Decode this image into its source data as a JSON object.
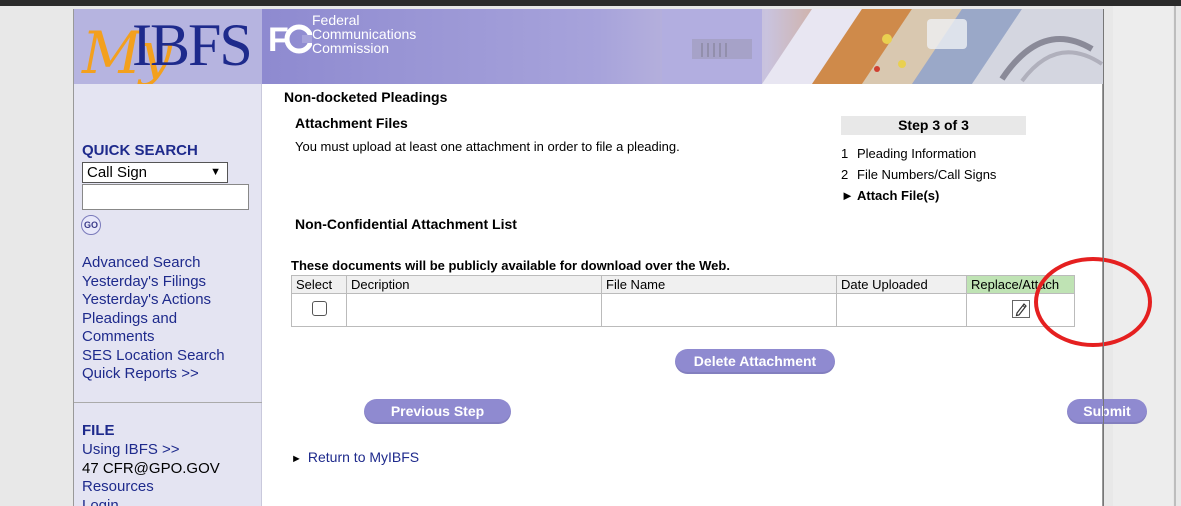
{
  "header": {
    "logo_my": "My",
    "logo_ibfs": "IBFS",
    "fcc_lines": [
      "Federal",
      "Communications",
      "Commission"
    ]
  },
  "sidebar": {
    "quick_search_title": "QUICK SEARCH",
    "search_type_selected": "Call Sign",
    "search_input_value": "",
    "go_label": "GO",
    "links": [
      "Advanced Search",
      "Yesterday's Filings",
      "Yesterday's Actions",
      "Pleadings and",
      "Comments",
      "SES Location Search",
      "Quick Reports >>"
    ],
    "file_title": "FILE",
    "file_links": [
      "Using IBFS >>",
      "47 CFR@GPO.GOV",
      "Resources",
      "Login"
    ]
  },
  "main": {
    "heading": "Non-docketed Pleadings",
    "attachment_title": "Attachment Files",
    "attachment_desc": "You must upload at least one attachment in order to file a pleading.",
    "steps_title": "Step 3 of 3",
    "steps": [
      {
        "num": "1",
        "label": "Pleading Information",
        "current": false
      },
      {
        "num": "2",
        "label": "File Numbers/Call Signs",
        "current": false
      },
      {
        "num": "►",
        "label": "Attach File(s)",
        "current": true
      }
    ],
    "list_title": "Non-Confidential Attachment List",
    "public_note": "These documents will be publicly available for download over the Web.",
    "table": {
      "headers": [
        "Select",
        "Decription",
        "File Name",
        "Date Uploaded",
        "Replace/Attach"
      ],
      "rows": [
        {
          "select": false,
          "description": "",
          "file_name": "",
          "date_uploaded": ""
        }
      ]
    },
    "delete_button": "Delete Attachment",
    "previous_button": "Previous Step",
    "submit_button": "Submit",
    "return_link": "Return to MyIBFS"
  },
  "colors": {
    "accent_purple": "#8f8ad0",
    "link_blue": "#1e2a8c",
    "highlight_red": "#e52020",
    "replace_header_green": "#bfe3b4"
  }
}
